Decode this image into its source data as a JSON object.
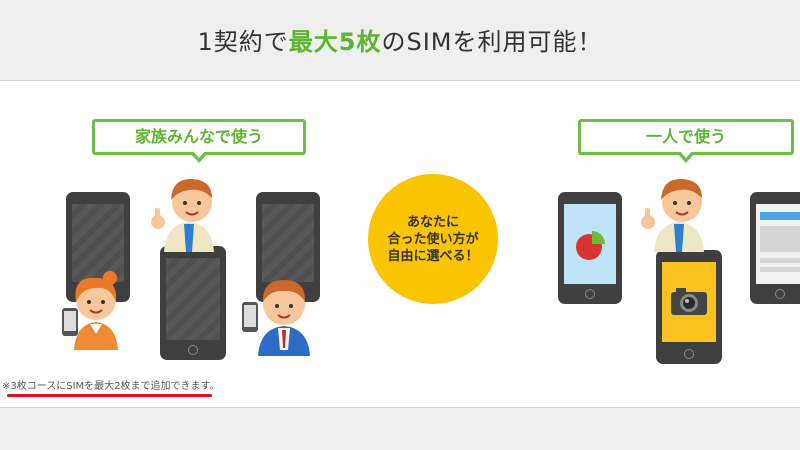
{
  "header": {
    "headline_pre": "1契約で",
    "headline_highlight": "最大5枚",
    "headline_post": "のSIMを利用可能！"
  },
  "family_panel": {
    "bubble_label": "家族みんなで使う"
  },
  "solo_panel": {
    "bubble_label": "一人で使う"
  },
  "center_badge": {
    "line1": "あなたに",
    "line2": "合った使い方が",
    "line3": "自由に選べる！"
  },
  "footnote": {
    "text": "※3枚コースにSIMを最大2枚まで追加できます。"
  },
  "colors": {
    "accent_green": "#5cb531",
    "badge_yellow": "#fac400",
    "underline_red": "#d8141b",
    "phone_dark": "#3f3f3f"
  },
  "icons": [
    "man-icon",
    "woman-icon",
    "boy-icon",
    "smartphone-icon",
    "pie-chart-icon",
    "camera-icon",
    "browser-window-icon"
  ]
}
